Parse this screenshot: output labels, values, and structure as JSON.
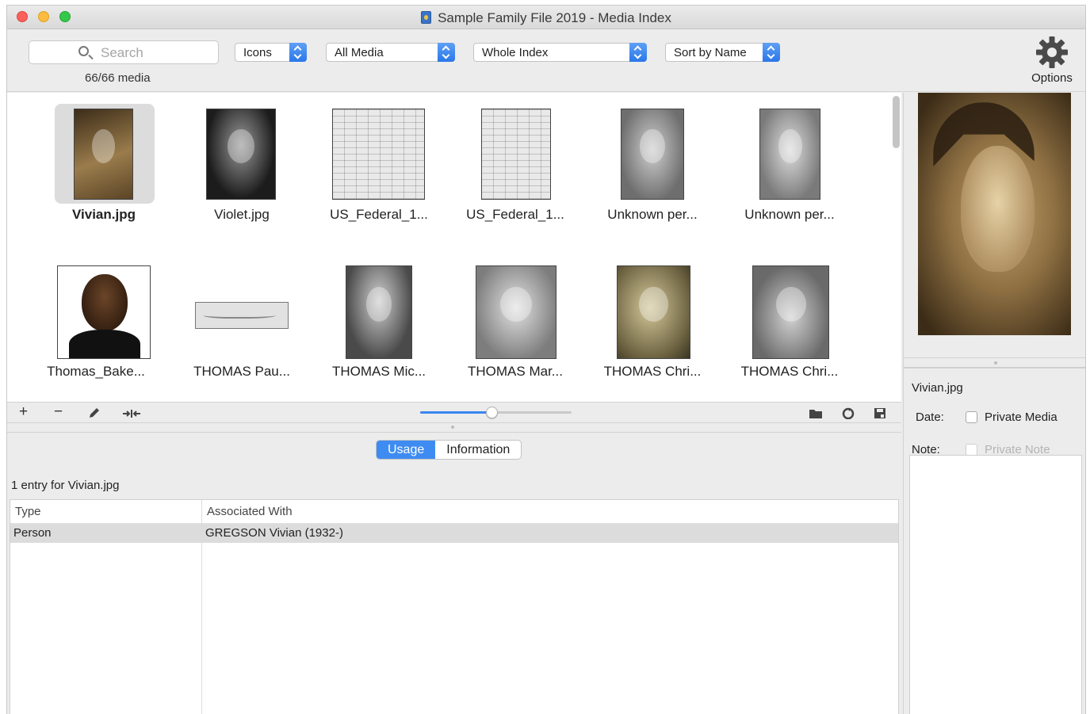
{
  "window": {
    "title": "Sample Family File 2019 - Media Index"
  },
  "toolbar": {
    "search_placeholder": "Search",
    "media_count": "66/66 media",
    "view_popup": "Icons",
    "filter_popup": "All Media",
    "scope_popup": "Whole Index",
    "sort_popup": "Sort by Name",
    "options_label": "Options"
  },
  "media": [
    {
      "caption": "Vivian.jpg",
      "selected": true,
      "style": "sepia-portrait"
    },
    {
      "caption": "Violet.jpg",
      "selected": false,
      "style": "bw-portrait"
    },
    {
      "caption": "US_Federal_1...",
      "selected": false,
      "style": "document"
    },
    {
      "caption": "US_Federal_1...",
      "selected": false,
      "style": "document"
    },
    {
      "caption": "Unknown per...",
      "selected": false,
      "style": "gray-portrait"
    },
    {
      "caption": "Unknown per...",
      "selected": false,
      "style": "gray-portrait"
    },
    {
      "caption": "Thomas_Bake...",
      "selected": false,
      "style": "color-portrait"
    },
    {
      "caption": "THOMAS Pau...",
      "selected": false,
      "style": "signature"
    },
    {
      "caption": "THOMAS Mic...",
      "selected": false,
      "style": "gray-portrait"
    },
    {
      "caption": "THOMAS Mar...",
      "selected": false,
      "style": "gray-portrait"
    },
    {
      "caption": "THOMAS Chri...",
      "selected": false,
      "style": "sepia-portrait"
    },
    {
      "caption": "THOMAS Chri...",
      "selected": false,
      "style": "gray-portrait"
    }
  ],
  "grid_toolbar": {
    "add_label": "+",
    "remove_label": "−",
    "thumbnail_size": 0.47
  },
  "tabs": [
    {
      "label": "Usage",
      "active": true
    },
    {
      "label": "Information",
      "active": false
    }
  ],
  "usage": {
    "entry_text": "1 entry for Vivian.jpg",
    "columns": [
      "Type",
      "Associated With"
    ],
    "rows": [
      {
        "type": "Person",
        "associated": "GREGSON Vivian (1932-)"
      }
    ]
  },
  "details": {
    "filename": "Vivian.jpg",
    "date_label": "Date:",
    "private_media_label": "Private Media",
    "private_media_checked": false,
    "note_label": "Note:",
    "private_note_label": "Private Note",
    "private_note_checked": false
  },
  "colors": {
    "accent": "#3e8cf2",
    "close": "#fc605b",
    "minimize": "#fdbc40",
    "maximize": "#34c84a"
  }
}
